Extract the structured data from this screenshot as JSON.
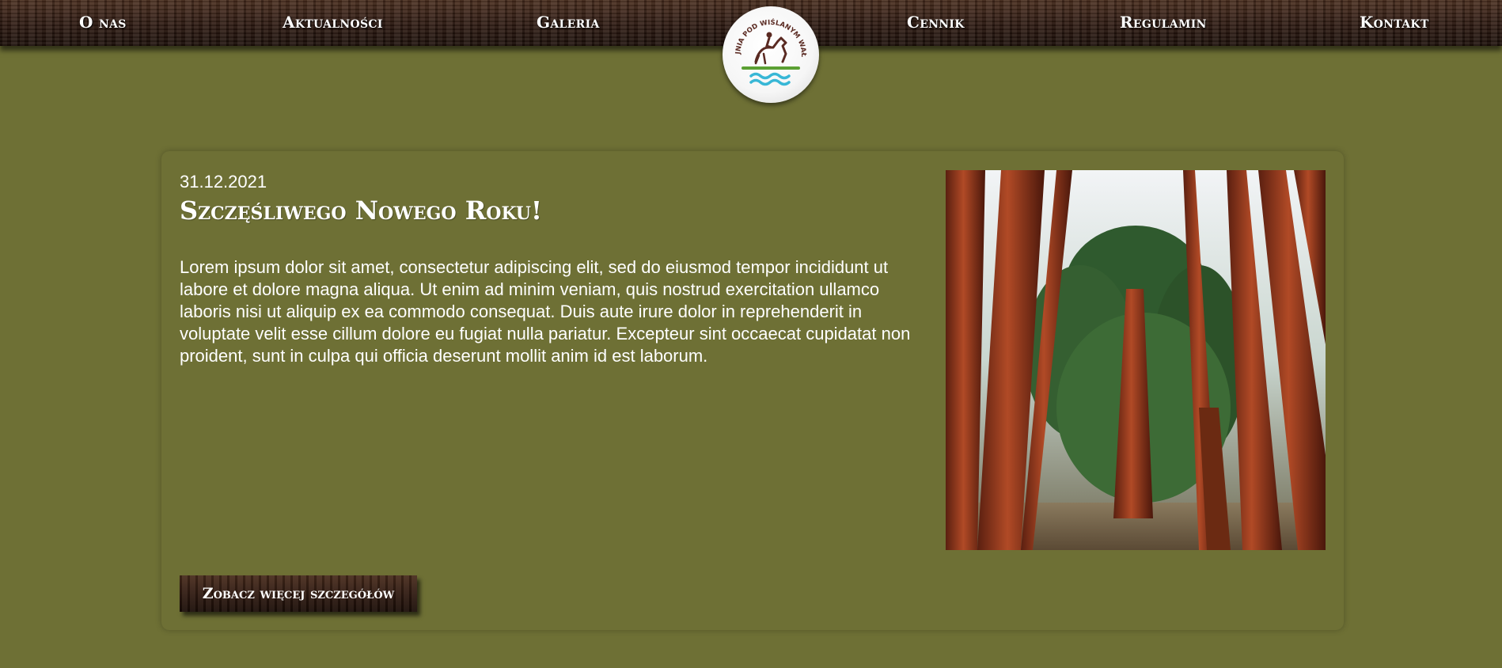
{
  "nav": {
    "items": [
      {
        "label": "O nas"
      },
      {
        "label": "Aktualności"
      },
      {
        "label": "Galeria"
      },
      {
        "label": "Cennik"
      },
      {
        "label": "Regulamin"
      },
      {
        "label": "Kontakt"
      }
    ]
  },
  "logo": {
    "text": "STAJNIA POD WIŚLANYM WAŁEM",
    "icon": "horse-rider-logo"
  },
  "post": {
    "date": "31.12.2021",
    "title": "Szczęśliwego Nowego Roku!",
    "body": "Lorem ipsum dolor sit amet, consectetur adipiscing elit, sed do eiusmod tempor incididunt ut labore et dolore magna aliqua. Ut enim ad minim veniam, quis nostrud exercitation ullamco laboris nisi ut aliquip ex ea commodo consequat. Duis aute irure dolor in reprehenderit in voluptate velit esse cillum dolore eu fugiat nulla pariatur. Excepteur sint occaecat cupidatat non proident, sunt in culpa qui officia deserunt mollit anim id est laborum.",
    "button_label": "Zobacz więcej szczegółów",
    "photo_icon": "sequoia-forest-photo"
  },
  "colors": {
    "background": "#6e7035",
    "wood": "#2c1810",
    "text": "#ffffff"
  }
}
